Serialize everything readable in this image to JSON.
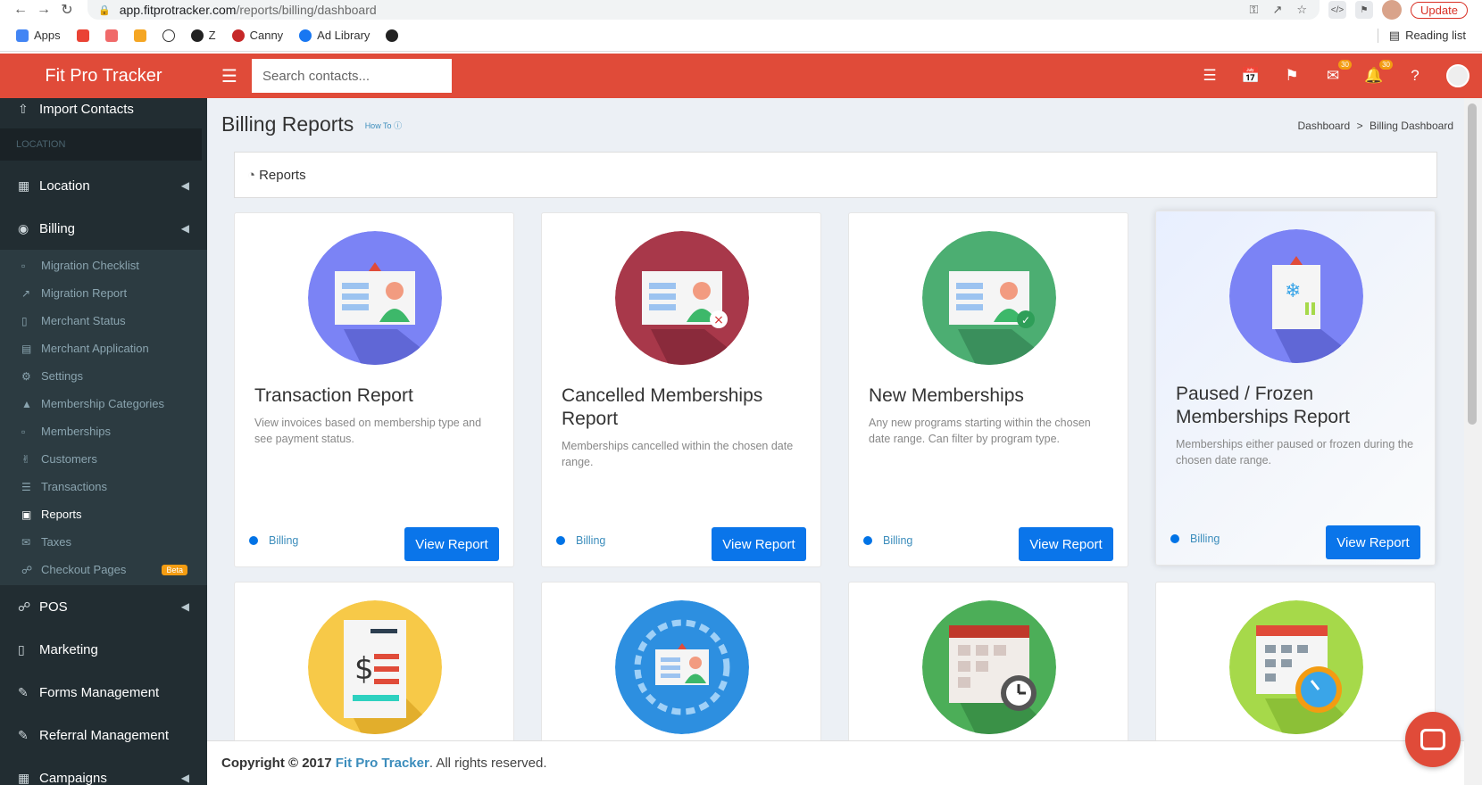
{
  "browser": {
    "url_host": "app.fitprotracker.com",
    "url_path": "/reports/billing/dashboard",
    "update_label": "Update",
    "bookmarks": [
      "Apps",
      "Z",
      "Canny",
      "Ad Library"
    ],
    "reading_list": "Reading list"
  },
  "topbar": {
    "brand": "Fit Pro Tracker",
    "search_placeholder": "Search contacts...",
    "mail_badge": "30",
    "bell_badge": "30"
  },
  "sidebar": {
    "import_contacts": "Import Contacts",
    "location_header": "LOCATION",
    "location": "Location",
    "billing": "Billing",
    "billing_items": [
      "Migration Checklist",
      "Migration Report",
      "Merchant Status",
      "Merchant Application",
      "Settings",
      "Membership Categories",
      "Memberships",
      "Customers",
      "Transactions",
      "Reports",
      "Taxes",
      "Checkout Pages"
    ],
    "beta_label": "Beta",
    "pos": "POS",
    "marketing": "Marketing",
    "forms": "Forms Management",
    "referral": "Referral Management",
    "campaigns": "Campaigns"
  },
  "page": {
    "title": "Billing Reports",
    "howto": "How To",
    "crumb_home": "Dashboard",
    "crumb_sep": ">",
    "crumb_current": "Billing Dashboard",
    "reports_label": "Reports"
  },
  "cards": [
    {
      "title": "Transaction Report",
      "desc": "View invoices based on membership type and see payment status.",
      "tag": "Billing",
      "button": "View Report",
      "color": "#7b83f5"
    },
    {
      "title": "Cancelled Memberships Report",
      "desc": "Memberships cancelled within the chosen date range.",
      "tag": "Billing",
      "button": "View Report",
      "color": "#a8384a"
    },
    {
      "title": "New Memberships",
      "desc": "Any new programs starting within the chosen date range. Can filter by program type.",
      "tag": "Billing",
      "button": "View Report",
      "color": "#4cae72"
    },
    {
      "title": "Paused / Frozen Memberships Report",
      "desc": "Memberships either paused or frozen during the chosen date range.",
      "tag": "Billing",
      "button": "View Report",
      "color": "#7b83f5"
    }
  ],
  "row2_colors": [
    "#f7c948",
    "#2d8fe0",
    "#4cae58",
    "#a6d94a"
  ],
  "footer": {
    "copyright": "Copyright © 2017",
    "brand": "Fit Pro Tracker",
    "rights": ". All rights reserved."
  }
}
